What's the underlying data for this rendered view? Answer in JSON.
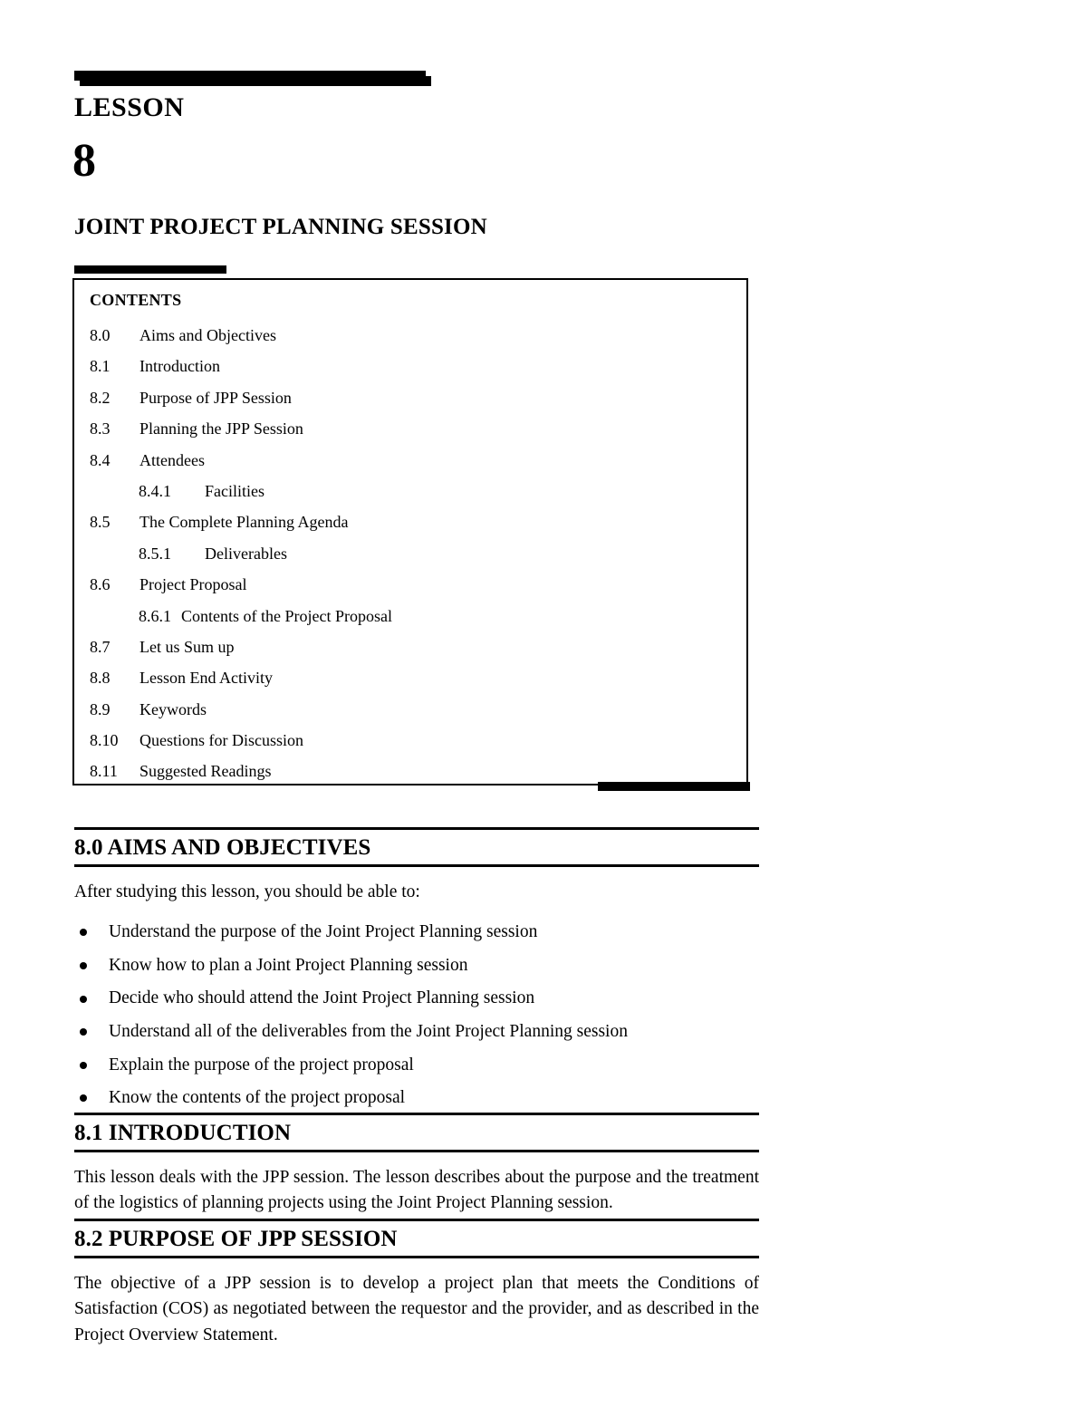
{
  "header": {
    "lesson_word": "LESSON",
    "lesson_number": "8",
    "lesson_title": "JOINT PROJECT PLANNING SESSION"
  },
  "contents": {
    "heading": "CONTENTS",
    "items": [
      {
        "num": "8.0",
        "label": "Aims and Objectives",
        "level": "main"
      },
      {
        "num": "8.1",
        "label": "Introduction",
        "level": "main"
      },
      {
        "num": "8.2",
        "label": "Purpose of JPP Session",
        "level": "main"
      },
      {
        "num": "8.3",
        "label": "Planning the JPP Session",
        "level": "main"
      },
      {
        "num": "8.4",
        "label": "Attendees",
        "level": "main"
      },
      {
        "num": "8.4.1",
        "label": "Facilities",
        "level": "sub"
      },
      {
        "num": "8.5",
        "label": "The Complete Planning Agenda",
        "level": "main"
      },
      {
        "num": "8.5.1",
        "label": "Deliverables",
        "level": "sub"
      },
      {
        "num": "8.6",
        "label": "Project Proposal",
        "level": "main"
      },
      {
        "num": "8.6.1",
        "label": "Contents of the Project Proposal",
        "level": "sub-tight"
      },
      {
        "num": "8.7",
        "label": "Let us Sum up",
        "level": "main"
      },
      {
        "num": "8.8",
        "label": "Lesson End Activity",
        "level": "main"
      },
      {
        "num": "8.9",
        "label": "Keywords",
        "level": "main"
      },
      {
        "num": "8.10",
        "label": "Questions for Discussion",
        "level": "main"
      },
      {
        "num": "8.11",
        "label": "Suggested Readings",
        "level": "main"
      }
    ]
  },
  "section_aims": {
    "title": "8.0 AIMS AND OBJECTIVES",
    "lead": "After studying this lesson, you should be able to:",
    "bullets": [
      "Understand the purpose of the Joint Project Planning session",
      "Know how to plan a Joint Project Planning session",
      "Decide who should attend the Joint Project Planning session",
      "Understand all of the deliverables from the Joint Project Planning session",
      "Explain the purpose of the project proposal",
      "Know the contents of the project proposal"
    ]
  },
  "section_introduction": {
    "title": "8.1 INTRODUCTION",
    "body": "This lesson deals with the JPP session. The lesson describes about the purpose and the treatment of the logistics of planning projects using the Joint Project Planning session."
  },
  "section_purpose": {
    "title": "8.2 PURPOSE OF JPP SESSION",
    "body": "The objective of a JPP session is to develop a project plan that meets the Conditions of Satisfaction (COS) as negotiated between the requestor and the provider, and as described in the Project Overview Statement."
  }
}
